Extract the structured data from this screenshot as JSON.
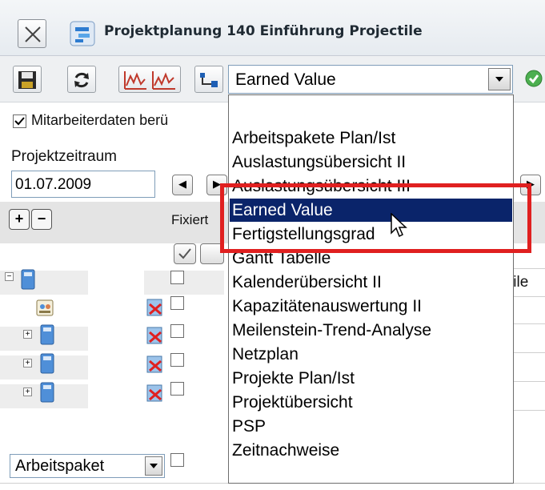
{
  "window": {
    "title": "Projektplanung 140 Einführung Projectile",
    "close_icon": "close-x-icon",
    "app_icon": "project-planning-icon"
  },
  "toolbar": {
    "buttons": [
      {
        "name": "save-icon"
      },
      {
        "name": "refresh-icon"
      },
      {
        "name": "chart-compare-icon"
      },
      {
        "name": "network-flow-icon"
      }
    ],
    "view_select": {
      "value": "Earned Value"
    },
    "ok_icon": "green-check-icon"
  },
  "form": {
    "mitarbeiterdaten_label": "Mitarbeiterdaten berü",
    "mitarbeiterdaten_checked": true,
    "projektzeitraum_label": "Projektzeitraum",
    "start_date": "01.07.2009",
    "fixiert_label": "Fixiert",
    "column_header_partial": "tile"
  },
  "tree": {
    "plus_label": "+",
    "minus_label": "−"
  },
  "bottom_select": {
    "value": "Arbeitspaket"
  },
  "dropdown": {
    "items": [
      {
        "label": "Arbeitspakete Plan/Ist",
        "selected": false
      },
      {
        "label": "Auslastungsübersicht II",
        "selected": false
      },
      {
        "label": "Auslastungsübersicht III",
        "selected": false
      },
      {
        "label": "Earned Value",
        "selected": true
      },
      {
        "label": "Fertigstellungsgrad",
        "selected": false
      },
      {
        "label": "Gantt Tabelle",
        "selected": false
      },
      {
        "label": "Kalenderübersicht II",
        "selected": false
      },
      {
        "label": "Kapazitätenauswertung II",
        "selected": false
      },
      {
        "label": "Meilenstein-Trend-Analyse",
        "selected": false
      },
      {
        "label": "Netzplan",
        "selected": false
      },
      {
        "label": "Projekte Plan/Ist",
        "selected": false
      },
      {
        "label": "Projektübersicht",
        "selected": false
      },
      {
        "label": "PSP",
        "selected": false
      },
      {
        "label": "Zeitnachweise",
        "selected": false
      }
    ]
  },
  "colors": {
    "selection": "#0a246a",
    "highlight": "#e02020"
  }
}
